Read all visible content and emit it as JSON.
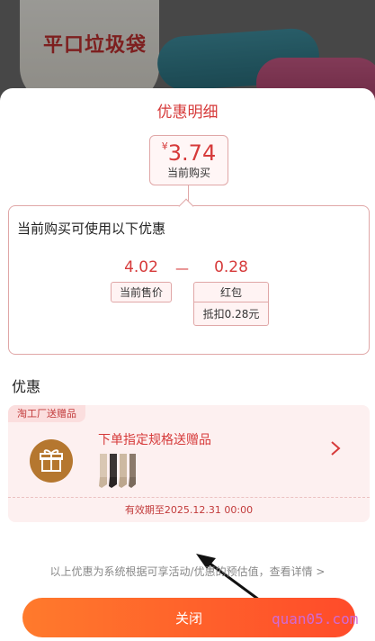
{
  "background": {
    "product_text": "平口垃圾袋"
  },
  "sheet": {
    "title": "优惠明细"
  },
  "price": {
    "currency": "¥",
    "value": "3.74",
    "label": "当前购买"
  },
  "detail": {
    "heading": "当前购买可使用以下优惠",
    "base_value": "4.02",
    "base_label": "当前售价",
    "operator": "—",
    "discount_value": "0.28",
    "discount_label": "红包",
    "discount_sub": "抵扣0.28元"
  },
  "offers": {
    "section_title": "优惠",
    "badge": "淘工厂送赠品",
    "title": "下单指定规格送赠品",
    "expiry": "有效期至2025.12.31 00:00"
  },
  "footnote": "以上优惠为系统根据可享活动/优惠的预估值，查看详情 >",
  "close_label": "关闭",
  "watermark": "quan05.com",
  "colors": {
    "accent_red": "#d63a3a",
    "button_start": "#ff7a2c",
    "button_end": "#ff4b2a",
    "gift_brown": "#b5772f"
  }
}
